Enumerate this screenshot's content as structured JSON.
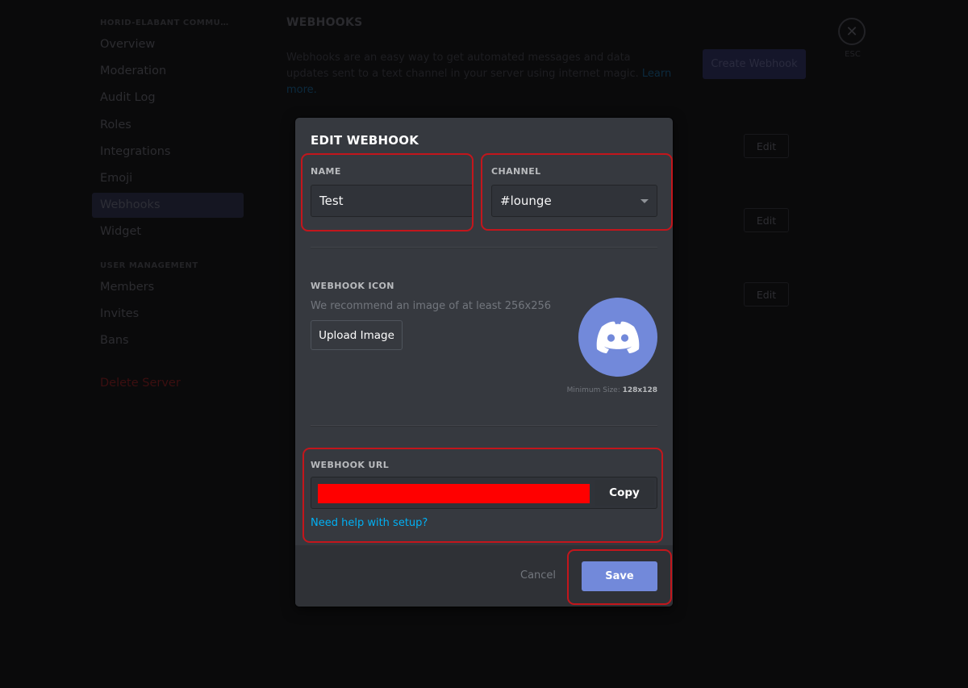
{
  "sidebar": {
    "server_header": "HORID-ELABANT COMMUNI...",
    "server_items": [
      {
        "label": "Overview"
      },
      {
        "label": "Moderation"
      },
      {
        "label": "Audit Log"
      },
      {
        "label": "Roles"
      },
      {
        "label": "Integrations"
      },
      {
        "label": "Emoji"
      },
      {
        "label": "Webhooks",
        "active": true
      },
      {
        "label": "Widget"
      }
    ],
    "user_header": "USER MANAGEMENT",
    "user_items": [
      {
        "label": "Members"
      },
      {
        "label": "Invites"
      },
      {
        "label": "Bans"
      }
    ],
    "delete_label": "Delete Server"
  },
  "page": {
    "title": "WEBHOOKS",
    "description": "Webhooks are an easy way to get automated messages and data updates sent to a text channel in your server using internet magic.",
    "learn_more": "Learn more.",
    "create_button": "Create Webhook",
    "edit_buttons": [
      "Edit",
      "Edit",
      "Edit"
    ],
    "esc_icon": "close-icon",
    "esc_label": "ESC"
  },
  "modal": {
    "title": "EDIT WEBHOOK",
    "name": {
      "label": "NAME",
      "value": "Test"
    },
    "channel": {
      "label": "CHANNEL",
      "value": "#lounge",
      "icon": "chevron-down-icon"
    },
    "icon_section": {
      "label": "WEBHOOK ICON",
      "hint": "We recommend an image of at least 256x256",
      "upload_button": "Upload Image",
      "avatar_icon": "discord-logo-icon",
      "min_size_label": "Minimum Size:",
      "min_size_value": "128x128"
    },
    "url_section": {
      "label": "WEBHOOK URL",
      "value_redacted": true,
      "copy_button": "Copy",
      "help_link": "Need help with setup?"
    },
    "footer": {
      "cancel": "Cancel",
      "save": "Save"
    }
  },
  "colors": {
    "accent": "#7289da",
    "link": "#00b0f4",
    "highlight": "#c3161c",
    "redaction": "#ff0000"
  }
}
